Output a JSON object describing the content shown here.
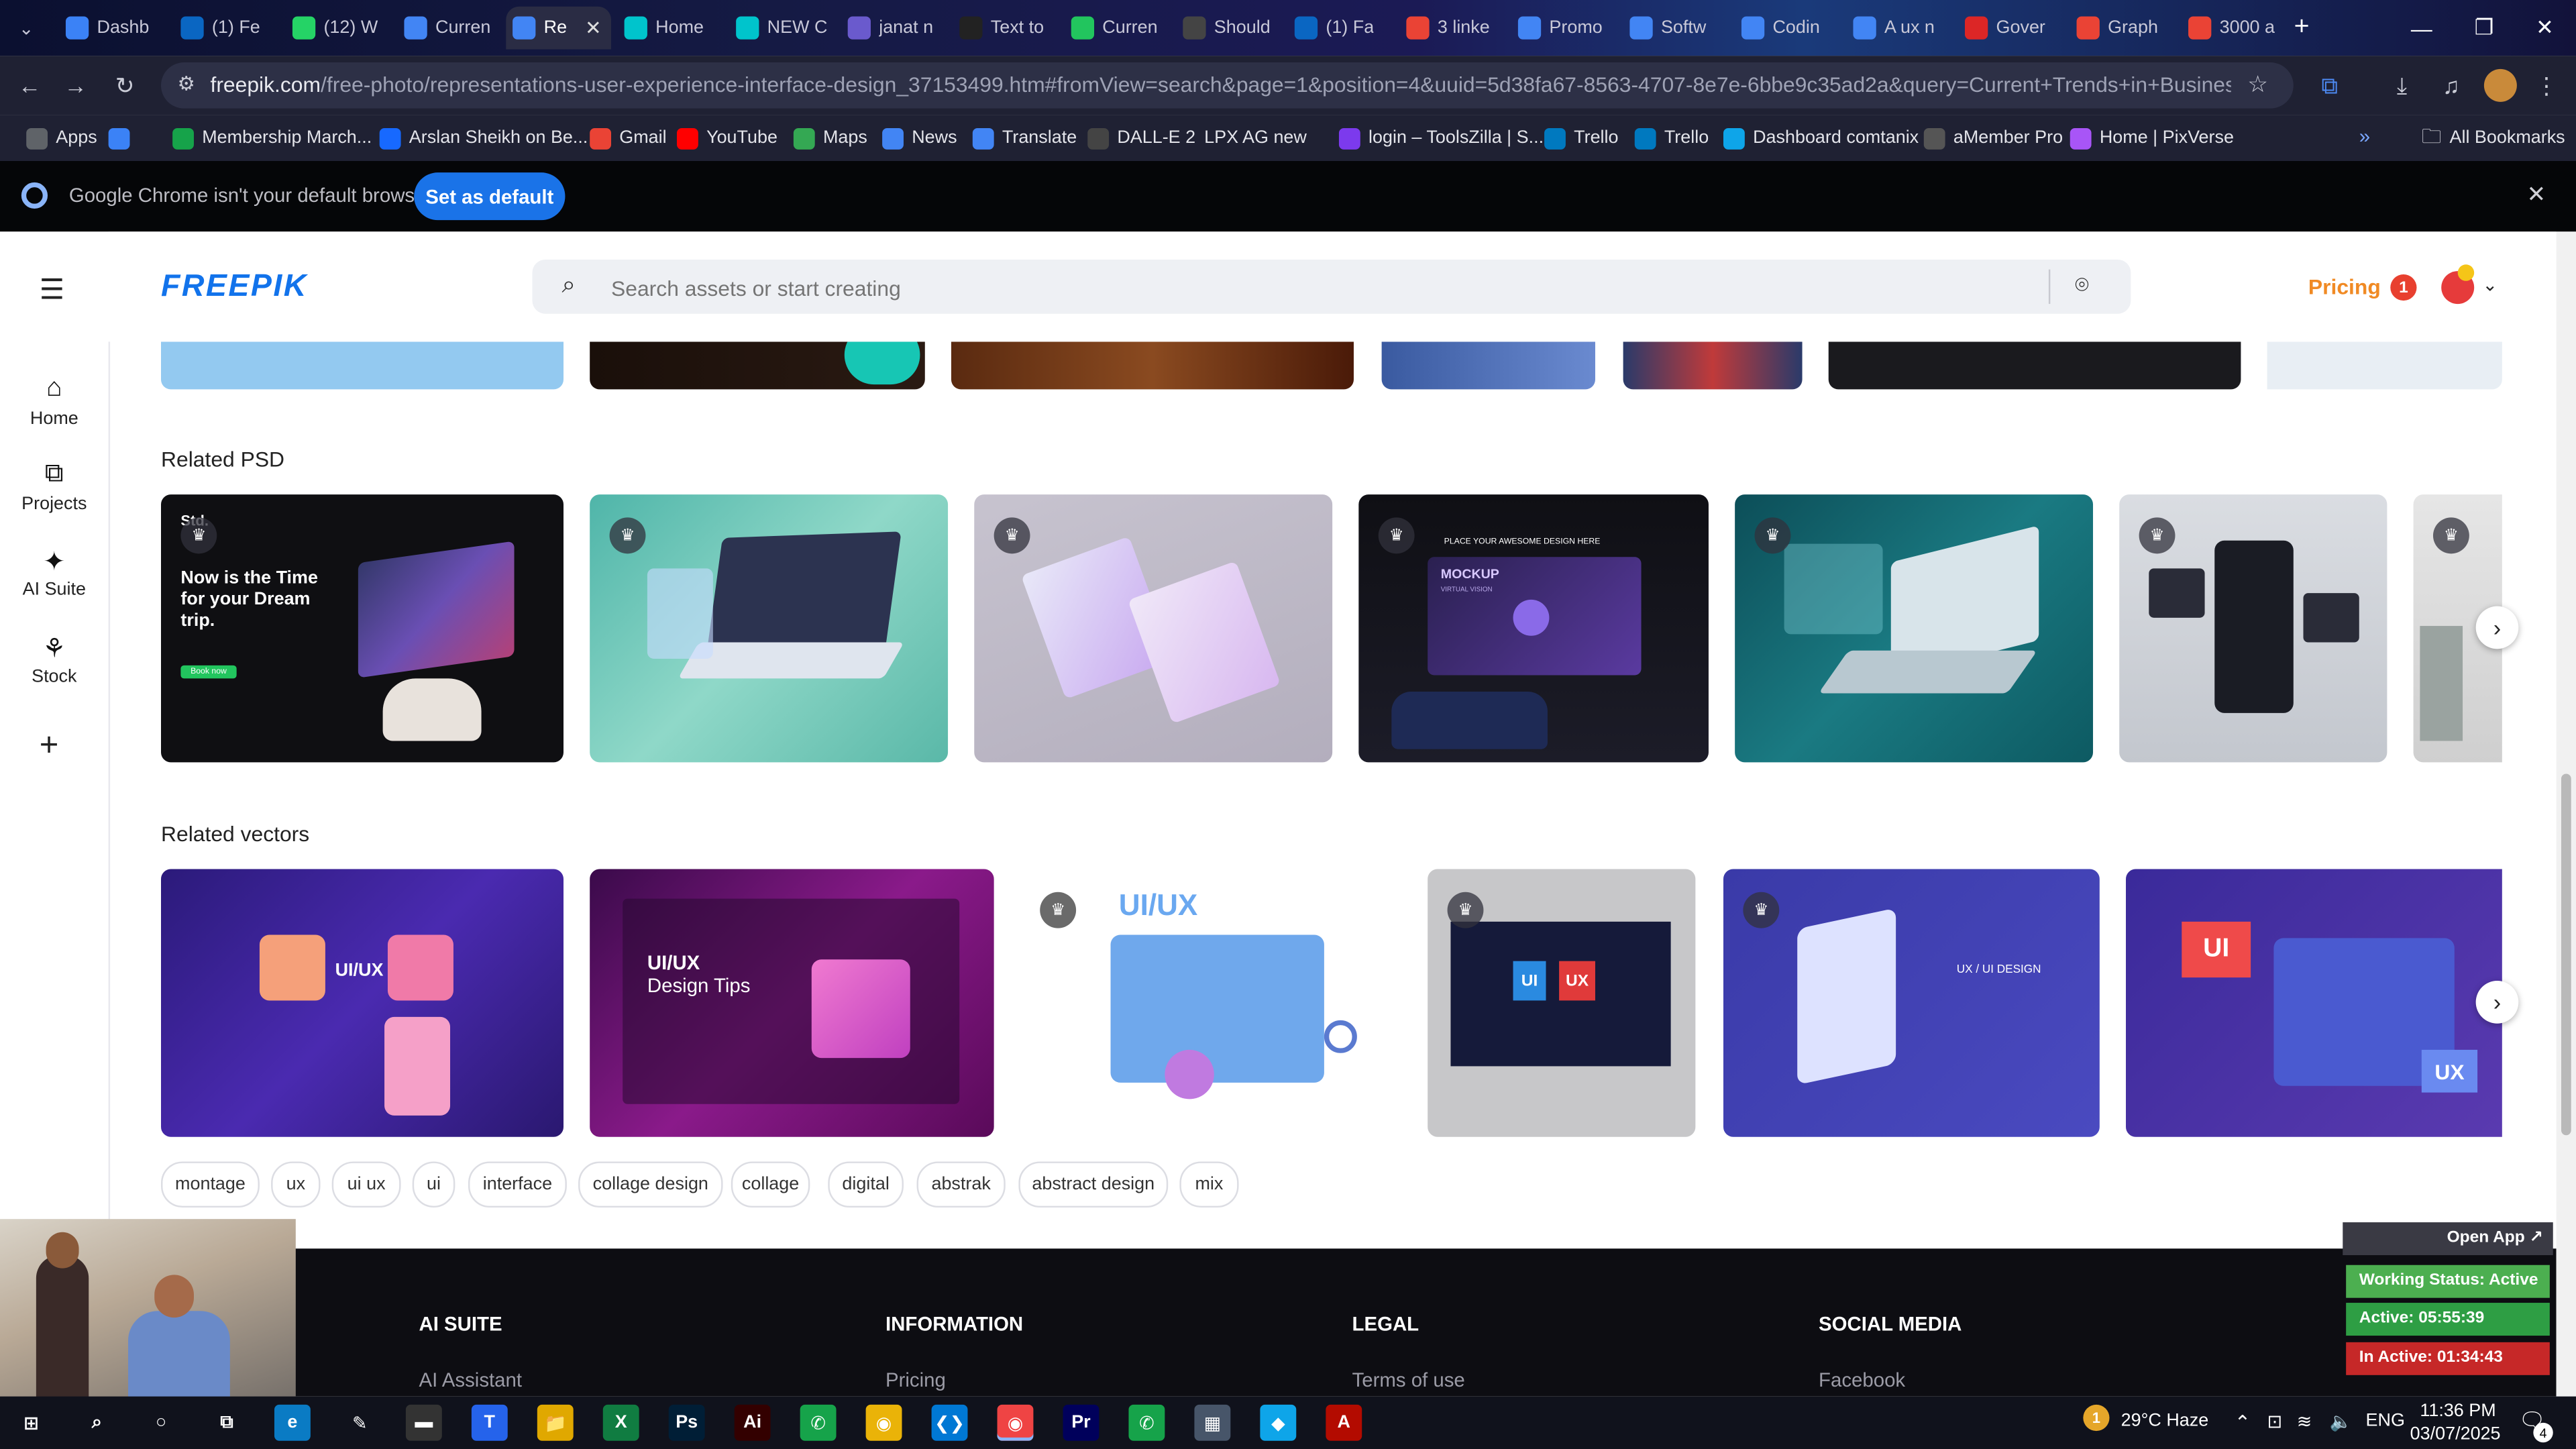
{
  "browser": {
    "tabs": [
      {
        "label": "Dashb",
        "icon": "globe-icon",
        "color": "#3b82f6"
      },
      {
        "label": "(1) Fe",
        "icon": "linkedin-icon",
        "color": "#0a66c2"
      },
      {
        "label": "(12) W",
        "icon": "whatsapp-icon",
        "color": "#25d366"
      },
      {
        "label": "Curren",
        "icon": "doc-icon",
        "color": "#4285f4"
      },
      {
        "label": "Re",
        "icon": "doc-icon",
        "color": "#4285f4"
      },
      {
        "label": "Home",
        "icon": "canva-icon",
        "color": "#00c4cc"
      },
      {
        "label": "NEW C",
        "icon": "canva-icon",
        "color": "#00c4cc"
      },
      {
        "label": "janat n",
        "icon": "video-icon",
        "color": "#6a5acd"
      },
      {
        "label": "Text to",
        "icon": "pause-icon",
        "color": "#222222"
      },
      {
        "label": "Curren",
        "icon": "sheet-icon",
        "color": "#22c55e"
      },
      {
        "label": "Should",
        "icon": "openai-icon",
        "color": "#444444"
      },
      {
        "label": "(1) Fa",
        "icon": "linkedin-icon",
        "color": "#0a66c2"
      },
      {
        "label": "3 linke",
        "icon": "google-icon",
        "color": "#ea4335"
      },
      {
        "label": "Promo",
        "icon": "doc-icon",
        "color": "#4285f4"
      },
      {
        "label": "Softw",
        "icon": "doc-icon",
        "color": "#4285f4"
      },
      {
        "label": "Codin",
        "icon": "doc-icon",
        "color": "#4285f4"
      },
      {
        "label": "A ux n",
        "icon": "doc-icon",
        "color": "#4285f4"
      },
      {
        "label": "Gover",
        "icon": "gem-icon",
        "color": "#dc2626"
      },
      {
        "label": "Graph",
        "icon": "gmail-icon",
        "color": "#ea4335"
      },
      {
        "label": "3000 a",
        "icon": "google-icon",
        "color": "#ea4335"
      }
    ],
    "url_host": "freepik.com",
    "url_rest": "/free-photo/representations-user-experience-interface-design_37153499.htm#fromView=search&page=1&position=4&uuid=5d38fa67-8563-4707-8e7e-6bbe9c35ad2a&query=Current+Trends+in+Business+Website+Design+and...",
    "bookmarks": [
      {
        "label": "Apps",
        "icon": "apps-grid-icon",
        "color": "#5f6368"
      },
      {
        "label": "",
        "icon": "grid-icon",
        "color": "#3b82f6"
      },
      {
        "label": "Membership March...",
        "icon": "plus-icon",
        "color": "#16a34a"
      },
      {
        "label": "Arslan Sheikh on Be...",
        "icon": "behance-icon",
        "color": "#1769ff"
      },
      {
        "label": "Gmail",
        "icon": "gmail-icon",
        "color": "#ea4335"
      },
      {
        "label": "YouTube",
        "icon": "youtube-icon",
        "color": "#ff0000"
      },
      {
        "label": "Maps",
        "icon": "maps-icon",
        "color": "#34a853"
      },
      {
        "label": "News",
        "icon": "news-icon",
        "color": "#4285f4"
      },
      {
        "label": "Translate",
        "icon": "translate-icon",
        "color": "#4285f4"
      },
      {
        "label": "DALL-E 2",
        "icon": "openai-icon",
        "color": "#444444"
      },
      {
        "label": "LPX AG new",
        "icon": "",
        "color": "#444444"
      },
      {
        "label": "login – ToolsZilla | S...",
        "icon": "toolszilla-icon",
        "color": "#7c3aed"
      },
      {
        "label": "Trello",
        "icon": "trello-icon",
        "color": "#0079bf"
      },
      {
        "label": "Trello",
        "icon": "trello-icon",
        "color": "#0079bf"
      },
      {
        "label": "Dashboard comtanix",
        "icon": "comtanix-icon",
        "color": "#0ea5e9"
      },
      {
        "label": "aMember Pro",
        "icon": "amember-icon",
        "color": "#555555"
      },
      {
        "label": "Home | PixVerse",
        "icon": "pixverse-icon",
        "color": "#a855f7"
      }
    ],
    "all_bookmarks": "All Bookmarks",
    "infobar_text": "Google Chrome isn't your default browser",
    "set_default": "Set as default"
  },
  "freepik": {
    "logo": "FREEPIK",
    "search_placeholder": "Search assets or start creating",
    "pricing": "Pricing",
    "notif_count": "1",
    "sidenav": [
      {
        "label": "Home",
        "icon": "home-icon"
      },
      {
        "label": "Projects",
        "icon": "projects-icon"
      },
      {
        "label": "AI Suite",
        "icon": "ai-suite-icon"
      },
      {
        "label": "Stock",
        "icon": "stock-icon"
      }
    ],
    "related_psd_title": "Related PSD",
    "psd_card_text": {
      "brand": "Std.",
      "headline": "Now is the Time for your Dream trip.",
      "button": "Book now"
    },
    "psd_mockup_labels": [
      "PLACE YOUR AWESOME DESIGN HERE",
      "MOCKUP",
      "VIRTUAL VISION"
    ],
    "related_vectors_title": "Related vectors",
    "vector_texts": {
      "uiux": "UI/UX",
      "tips_title": "UI/UX",
      "tips_sub": "Design Tips",
      "uiux_banner": "UI/UX",
      "ui": "UI",
      "ux": "UX",
      "ux_ui_design": "UX / UI DESIGN"
    },
    "tags": [
      "montage",
      "ux",
      "ui ux",
      "ui",
      "interface",
      "collage design",
      "collage",
      "digital",
      "abstrak",
      "abstract design",
      "mix"
    ],
    "footer": [
      {
        "heading": "AI SUITE",
        "link": "AI Assistant"
      },
      {
        "heading": "INFORMATION",
        "link": "Pricing"
      },
      {
        "heading": "LEGAL",
        "link": "Terms of use"
      },
      {
        "heading": "SOCIAL MEDIA",
        "link": "Facebook"
      }
    ]
  },
  "tracker": {
    "open_app": "Open App ↗",
    "status": "Working Status: Active",
    "active": "Active: 05:55:39",
    "inactive": "In Active: 01:34:43",
    "colors": {
      "status": "#4caf50",
      "active": "#2e9e44",
      "inactive": "#c62828"
    }
  },
  "taskbar": {
    "weather": "29°C Haze",
    "weather_badge": "1",
    "lang": "ENG",
    "time": "11:36 PM",
    "date": "03/07/2025",
    "notification_count": "4",
    "apps": [
      {
        "name": "start-button",
        "glyph": "⊞",
        "color": "transparent"
      },
      {
        "name": "search-icon",
        "glyph": "⌕",
        "color": "transparent"
      },
      {
        "name": "cortana-icon",
        "glyph": "○",
        "color": "transparent"
      },
      {
        "name": "task-view-icon",
        "glyph": "⧉",
        "color": "transparent"
      },
      {
        "name": "edge-icon",
        "glyph": "e",
        "color": "#0a7bc4"
      },
      {
        "name": "pen-icon",
        "glyph": "✎",
        "color": "transparent"
      },
      {
        "name": "terminal-icon",
        "glyph": "▬",
        "color": "#333333"
      },
      {
        "name": "teams-icon",
        "glyph": "T",
        "color": "#2563eb"
      },
      {
        "name": "file-explorer-icon",
        "glyph": "📁",
        "color": "#e0a800"
      },
      {
        "name": "excel-icon",
        "glyph": "X",
        "color": "#107c41"
      },
      {
        "name": "photoshop-icon",
        "glyph": "Ps",
        "color": "#001e36"
      },
      {
        "name": "illustrator-icon",
        "glyph": "Ai",
        "color": "#330000"
      },
      {
        "name": "phone-icon",
        "glyph": "✆",
        "color": "#16a34a"
      },
      {
        "name": "chrome-icon",
        "glyph": "◉",
        "color": "#eab308"
      },
      {
        "name": "vscode-icon",
        "glyph": "❮❯",
        "color": "#0078d4"
      },
      {
        "name": "chrome-active-icon",
        "glyph": "◉",
        "color": "#ef4444"
      },
      {
        "name": "premiere-icon",
        "glyph": "Pr",
        "color": "#00005b"
      },
      {
        "name": "phone-link-icon",
        "glyph": "✆",
        "color": "#16a34a"
      },
      {
        "name": "calculator-icon",
        "glyph": "▦",
        "color": "#475569"
      },
      {
        "name": "app-icon",
        "glyph": "◆",
        "color": "#0ea5e9"
      },
      {
        "name": "acrobat-icon",
        "glyph": "A",
        "color": "#b30b00"
      }
    ]
  }
}
